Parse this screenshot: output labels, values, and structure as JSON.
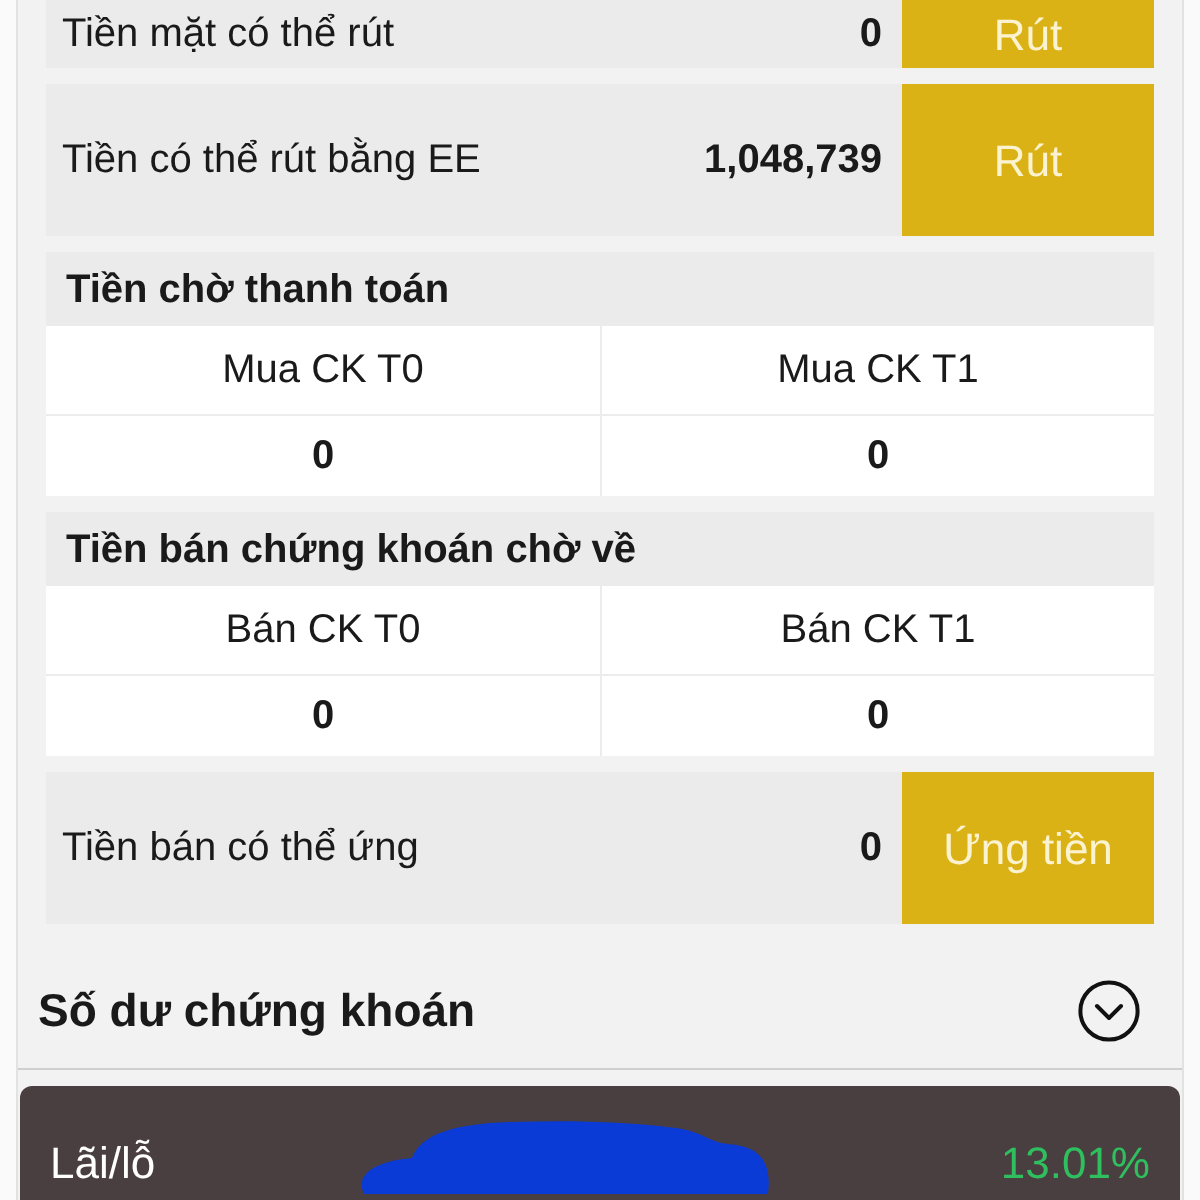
{
  "cash_items": [
    {
      "kind": "action",
      "label": "Tiền mặt có thể rút",
      "value": "0",
      "button": "Rút"
    },
    {
      "kind": "action",
      "label": "Tiền có thể rút bằng EE",
      "value": "1,048,739",
      "button": "Rút"
    },
    {
      "kind": "pending",
      "title": "Tiền chờ thanh toán",
      "columns": [
        {
          "header": "Mua CK T0",
          "value": "0"
        },
        {
          "header": "Mua CK T1",
          "value": "0"
        }
      ]
    },
    {
      "kind": "pending",
      "title": "Tiền bán chứng khoán chờ về",
      "columns": [
        {
          "header": "Bán CK T0",
          "value": "0"
        },
        {
          "header": "Bán CK T1",
          "value": "0"
        }
      ]
    },
    {
      "kind": "action",
      "label": "Tiền bán có thể ứng",
      "value": "0",
      "button": "Ứng tiền"
    }
  ],
  "securities_balance": {
    "title": "Số dư chứng khoán"
  },
  "profit_card": {
    "label": "Lãi/lỗ",
    "value": "13.01%"
  }
}
